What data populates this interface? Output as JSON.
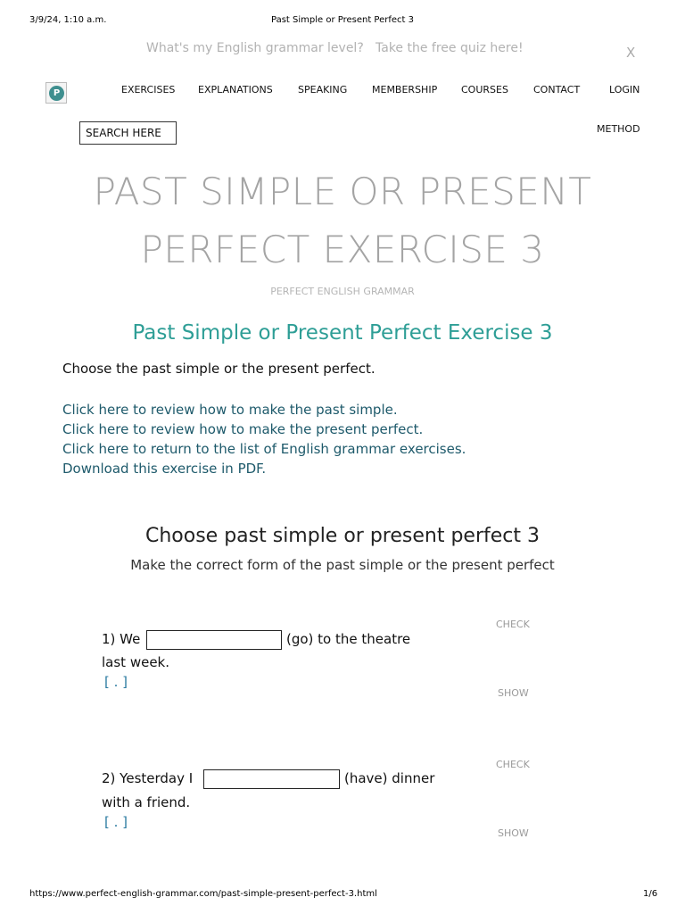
{
  "print_header": {
    "datetime": "3/9/24, 1:10 a.m.",
    "title": "Past Simple or Present Perfect 3"
  },
  "banner": {
    "question": "What's my English grammar level?",
    "cta": "Take the free quiz here!",
    "close": "X"
  },
  "logo": {
    "letter": "P"
  },
  "nav": {
    "items": [
      "EXERCISES",
      "EXPLANATIONS",
      "SPEAKING",
      "MEMBERSHIP",
      "COURSES",
      "CONTACT",
      "LOGIN"
    ],
    "search_label": "SEARCH HERE",
    "method": "METHOD"
  },
  "page": {
    "title_line1": "PAST SIMPLE OR PRESENT",
    "title_line2": "PERFECT EXERCISE 3",
    "site": "PERFECT ENGLISH GRAMMAR",
    "heading": "Past Simple or Present Perfect Exercise 3",
    "intro": "Choose the past simple or the present perfect.",
    "links": [
      "Click here to review how to make the past simple.",
      "Click here to review how to make the present perfect.",
      "Click here to return to the list of English grammar exercises.",
      "Download this exercise in PDF."
    ]
  },
  "exercise": {
    "title": "Choose past simple or present perfect 3",
    "subtitle": "Make the correct form of the past simple or the present perfect",
    "check_label": "CHECK",
    "show_label": "SHOW",
    "hint": "[ . ]",
    "questions": [
      {
        "prefix": "1) We",
        "answer": "",
        "suffix": "(go) to the theatre",
        "line2": "last week."
      },
      {
        "prefix": "2) Yesterday I",
        "answer": "",
        "suffix": "(have) dinner",
        "line2": "with a friend."
      }
    ]
  },
  "print_footer": {
    "url": "https://www.perfect-english-grammar.com/past-simple-present-perfect-3.html",
    "page": "1/6"
  }
}
